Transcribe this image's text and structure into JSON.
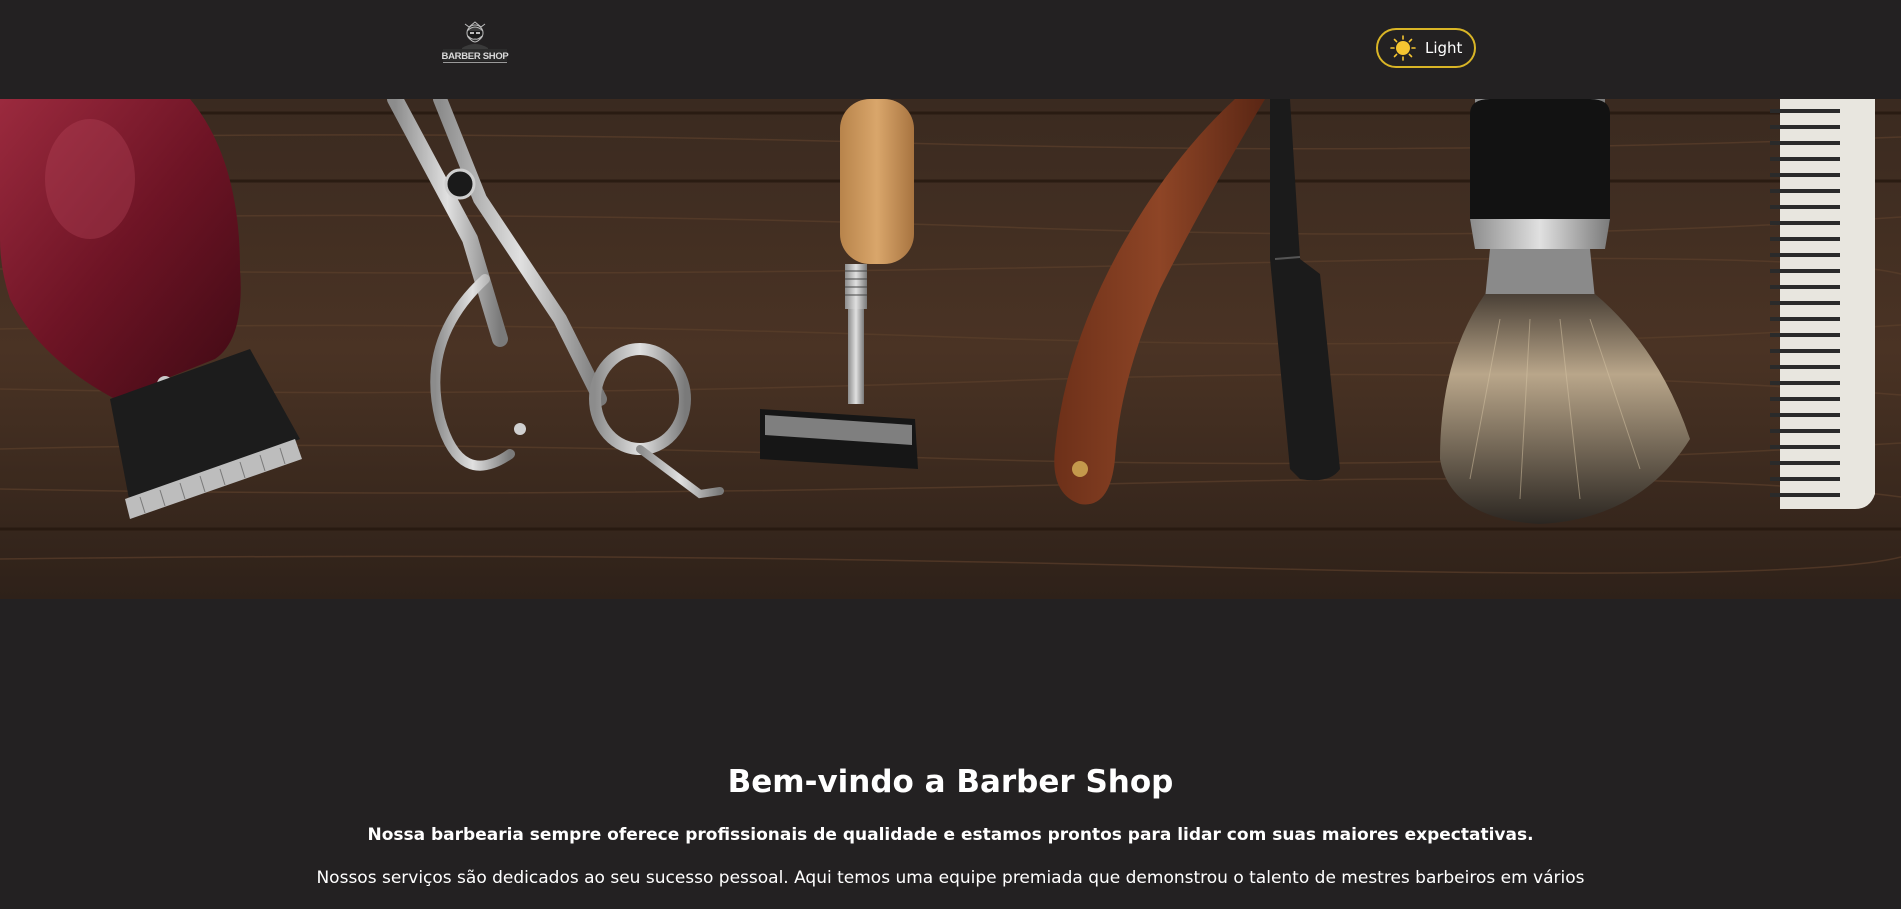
{
  "header": {
    "logo": {
      "text": "BARBER SHOP",
      "icon": "bearded-barber-logo-icon"
    },
    "theme_toggle": {
      "icon": "sun-icon",
      "label": "Light",
      "border_color": "#d9b526",
      "icon_color": "#f5c531"
    }
  },
  "hero": {
    "image": "barber-tools-on-wood-image",
    "tools": [
      "hair-clipper",
      "scissors",
      "safety-razor",
      "straight-razor",
      "shaving-brush",
      "comb"
    ]
  },
  "welcome": {
    "title": "Bem-vindo a Barber Shop",
    "lead": "Nossa barbearia sempre oferece profissionais de qualidade e estamos prontos para lidar com suas maiores expectativas.",
    "body": "Nossos serviços são dedicados ao seu sucesso pessoal. Aqui temos uma equipe premiada que demonstrou o talento de mestres barbeiros em vários"
  },
  "colors": {
    "background": "#232122",
    "text": "#ffffff",
    "accent": "#d9b526"
  }
}
